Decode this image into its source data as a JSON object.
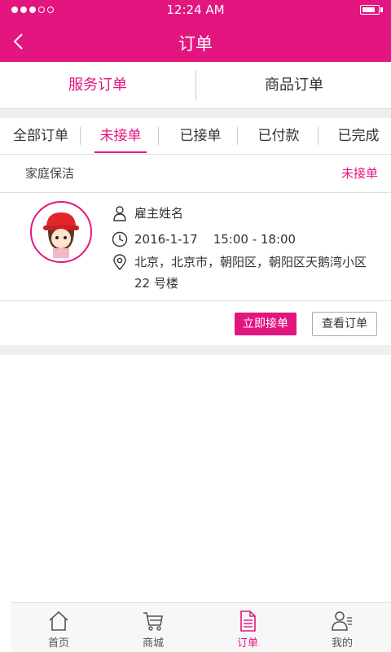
{
  "status_bar": {
    "time": "12:24 AM",
    "signal_strength": 3,
    "signal_max": 5,
    "battery_level": 0.85
  },
  "header": {
    "title": "订单"
  },
  "segment": {
    "items": [
      {
        "label": "服务订单",
        "active": true
      },
      {
        "label": "商品订单",
        "active": false
      }
    ]
  },
  "tabs": [
    {
      "label": "全部订单"
    },
    {
      "label": "未接单"
    },
    {
      "label": "已接单"
    },
    {
      "label": "已付款"
    },
    {
      "label": "已完成"
    }
  ],
  "order": {
    "service": "家庭保洁",
    "status": "未接单",
    "employer": "雇主姓名",
    "datetime": "2016-1-17    15:00 - 18:00",
    "address": "北京，北京市，朝阳区，朝阳区天鹅湾小区 22 号楼",
    "accept_label": "立即接单",
    "view_label": "查看订单"
  },
  "bottom_nav": [
    {
      "label": "首页",
      "icon": "home-icon"
    },
    {
      "label": "商城",
      "icon": "cart-icon"
    },
    {
      "label": "订单",
      "icon": "document-icon"
    },
    {
      "label": "我的",
      "icon": "user-icon"
    }
  ],
  "colors": {
    "accent": "#e3157f",
    "background": "#efefef"
  }
}
